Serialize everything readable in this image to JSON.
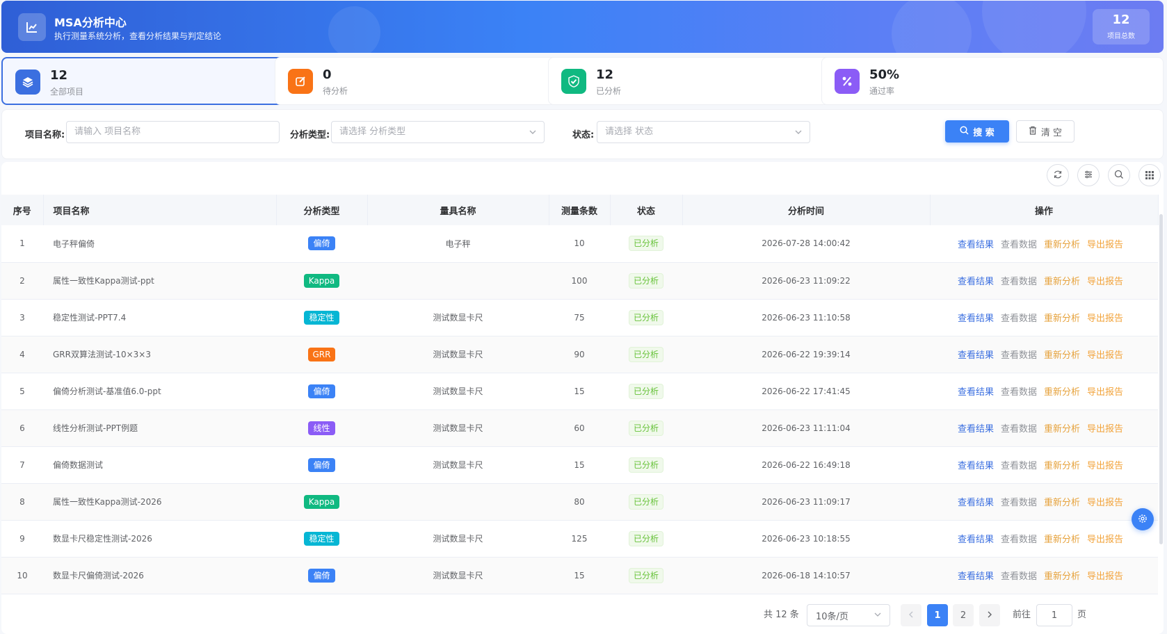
{
  "header": {
    "title": "MSA分析中心",
    "subtitle": "执行测量系统分析，查看分析结果与判定结论",
    "total_value": "12",
    "total_label": "项目总数",
    "logo_icon": "chart-line-icon"
  },
  "cards": [
    {
      "value": "12",
      "label": "全部项目",
      "color": "#3b6fe0",
      "icon": "layers-icon"
    },
    {
      "value": "0",
      "label": "待分析",
      "color": "#f97316",
      "icon": "edit-icon"
    },
    {
      "value": "12",
      "label": "已分析",
      "color": "#10b981",
      "icon": "check-icon"
    },
    {
      "value": "50%",
      "label": "通过率",
      "color": "#8b5cf6",
      "icon": "percent-icon"
    }
  ],
  "search": {
    "name_label": "项目名称:",
    "name_placeholder": "请输入 项目名称",
    "type_label": "分析类型:",
    "type_placeholder": "请选择 分析类型",
    "status_label": "状态:",
    "status_placeholder": "请选择 状态",
    "search_button": "搜 索",
    "clear_button": "清 空"
  },
  "table": {
    "columns": [
      "序号",
      "项目名称",
      "分析类型",
      "量具名称",
      "测量条数",
      "状态",
      "分析时间",
      "操作"
    ],
    "actions": {
      "view": "查看结果",
      "data": "查看数据",
      "redo": "重新分析",
      "export": "导出报告"
    },
    "rows": [
      {
        "no": "1",
        "name": "电子秤偏倚",
        "type": "偏倚",
        "type_color": "#3b82f6",
        "gauge": "电子秤",
        "count": "10",
        "status": "已分析",
        "time": "2026-07-28 14:00:42"
      },
      {
        "no": "2",
        "name": "属性一致性Kappa测试-ppt",
        "type": "Kappa",
        "type_color": "#10b981",
        "gauge": "",
        "count": "100",
        "status": "已分析",
        "time": "2026-06-23 11:09:22"
      },
      {
        "no": "3",
        "name": "稳定性测试-PPT7.4",
        "type": "稳定性",
        "type_color": "#06b6d4",
        "gauge": "测试数显卡尺",
        "count": "75",
        "status": "已分析",
        "time": "2026-06-23 11:10:58"
      },
      {
        "no": "4",
        "name": "GRR双算法测试-10×3×3",
        "type": "GRR",
        "type_color": "#f97316",
        "gauge": "测试数显卡尺",
        "count": "90",
        "status": "已分析",
        "time": "2026-06-22 19:39:14"
      },
      {
        "no": "5",
        "name": "偏倚分析测试-基准值6.0-ppt",
        "type": "偏倚",
        "type_color": "#3b82f6",
        "gauge": "测试数显卡尺",
        "count": "15",
        "status": "已分析",
        "time": "2026-06-22 17:41:45"
      },
      {
        "no": "6",
        "name": "线性分析测试-PPT例题",
        "type": "线性",
        "type_color": "#8b5cf6",
        "gauge": "测试数显卡尺",
        "count": "60",
        "status": "已分析",
        "time": "2026-06-23 11:11:04"
      },
      {
        "no": "7",
        "name": "偏倚数据测试",
        "type": "偏倚",
        "type_color": "#3b82f6",
        "gauge": "测试数显卡尺",
        "count": "15",
        "status": "已分析",
        "time": "2026-06-22 16:49:18"
      },
      {
        "no": "8",
        "name": "属性一致性Kappa测试-2026",
        "type": "Kappa",
        "type_color": "#10b981",
        "gauge": "",
        "count": "80",
        "status": "已分析",
        "time": "2026-06-23 11:09:17"
      },
      {
        "no": "9",
        "name": "数显卡尺稳定性测试-2026",
        "type": "稳定性",
        "type_color": "#06b6d4",
        "gauge": "测试数显卡尺",
        "count": "125",
        "status": "已分析",
        "time": "2026-06-23 10:18:55"
      },
      {
        "no": "10",
        "name": "数显卡尺偏倚测试-2026",
        "type": "偏倚",
        "type_color": "#3b82f6",
        "gauge": "测试数显卡尺",
        "count": "15",
        "status": "已分析",
        "time": "2026-06-18 14:10:57"
      }
    ]
  },
  "pagination": {
    "total": "共 12 条",
    "page_size": "10条/页",
    "pages": [
      "1",
      "2"
    ],
    "current": "1",
    "goto_label": "前往",
    "goto_value": "1",
    "page_suffix": "页"
  }
}
